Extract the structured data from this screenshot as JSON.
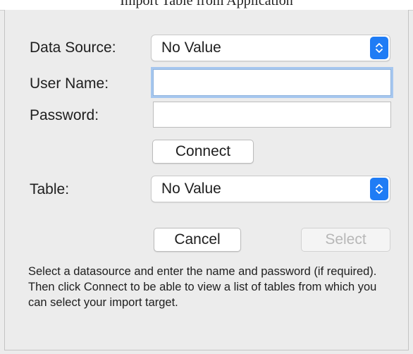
{
  "window": {
    "title": "Import Table from Application"
  },
  "form": {
    "data_source_label": "Data Source:",
    "data_source_value": "No Value",
    "user_name_label": "User Name:",
    "user_name_value": "",
    "password_label": "Password:",
    "password_value": "",
    "connect_label": "Connect",
    "table_label": "Table:",
    "table_value": "No Value",
    "cancel_label": "Cancel",
    "select_label": "Select"
  },
  "help": {
    "text": "Select a datasource and enter the name and password (if required).  Then click Connect to be able to view a list of tables from which you can select your import target."
  },
  "colors": {
    "accent": "#1f7cf5",
    "focus_ring": "#a6c7ef",
    "background": "#ececec"
  },
  "icons": {
    "popup_arrows": "up-down-chevrons-icon"
  }
}
